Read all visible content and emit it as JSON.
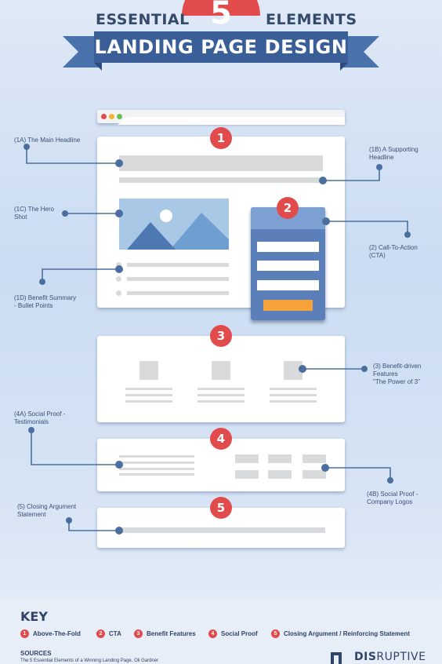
{
  "header": {
    "number": "5",
    "word_left": "ESSENTIAL",
    "word_right": "ELEMENTS",
    "ribbon": "LANDING PAGE DESIGN"
  },
  "sections": {
    "s1": "1",
    "s2": "2",
    "s3": "3",
    "s4": "4",
    "s5": "5"
  },
  "labels": {
    "l1a": "(1A) The Main Headline",
    "l1b_1": "(1B) A Supporting",
    "l1b_2": "Headline",
    "l1c_1": "(1C) The Hero",
    "l1c_2": "Shot",
    "l1d_1": "(1D) Benefit Summary",
    "l1d_2": "- Bullet Points",
    "l2_1": "(2) Call-To-Action",
    "l2_2": "(CTA)",
    "l3_1": "(3) Benefit-driven",
    "l3_2": "Features",
    "l3_3": "\"The Power of 3\"",
    "l4a_1": "(4A) Social Proof -",
    "l4a_2": "Testimonials",
    "l4b_1": "(4B) Social Proof -",
    "l4b_2": "Company Logos",
    "l5_1": "(5) Closing Argument",
    "l5_2": "Statement"
  },
  "key": {
    "title": "KEY",
    "items": [
      {
        "n": "1",
        "label": "Above-The-Fold"
      },
      {
        "n": "2",
        "label": "CTA"
      },
      {
        "n": "3",
        "label": "Benefit Features"
      },
      {
        "n": "4",
        "label": "Social Proof"
      },
      {
        "n": "5",
        "label": "Closing Argument / Reinforcing Statement"
      }
    ]
  },
  "sources": {
    "title": "SOURCES",
    "text": "The 5 Essential Elements of a Winning Landing Page, Oli Gardner"
  },
  "brand": {
    "bold": "DIS",
    "rest": "RUPTIVE"
  },
  "colors": {
    "accent_red": "#e14b4b",
    "navy": "#2e4469",
    "cta_blue": "#5b7fb8",
    "cta_button": "#f5a23a"
  }
}
